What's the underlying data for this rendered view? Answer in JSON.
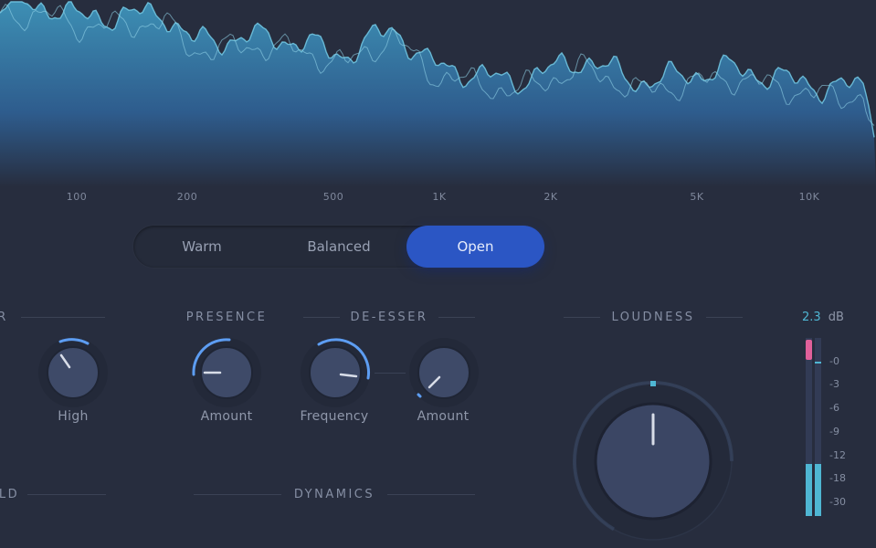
{
  "spectrum": {
    "freq_labels": [
      "100",
      "200",
      "500",
      "1K",
      "2K",
      "5K",
      "10K"
    ]
  },
  "tone_selector": {
    "options": [
      "Warm",
      "Balanced",
      "Open"
    ],
    "selected": "Open"
  },
  "sections": {
    "left_partial_label": "R",
    "presence_label": "PRESENCE",
    "deesser_label": "DE-ESSER",
    "loudness_label": "LOUDNESS",
    "bottom_left_partial_label": "LD",
    "dynamics_label": "DYNAMICS"
  },
  "knobs": {
    "high": {
      "label": "High"
    },
    "presence_amount": {
      "label": "Amount"
    },
    "deesser_frequency": {
      "label": "Frequency"
    },
    "deesser_amount": {
      "label": "Amount"
    }
  },
  "meter": {
    "value": "2.3",
    "unit": "dB",
    "scale": [
      "-0",
      "-3",
      "-6",
      "-9",
      "-12",
      "-18",
      "-30"
    ]
  },
  "colors": {
    "background": "#272d3e",
    "accent_blue": "#2b56c4",
    "spectrum_cyan": "#4fb6d3",
    "peak_pink": "#e0609a"
  }
}
